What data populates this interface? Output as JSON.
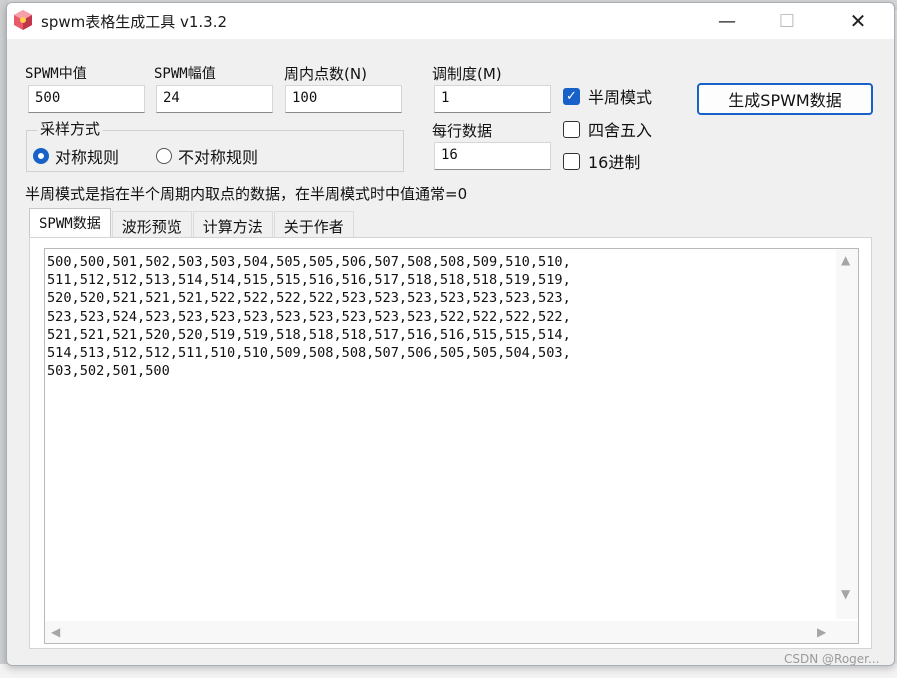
{
  "window": {
    "title": "spwm表格生成工具 v1.3.2",
    "min_glyph": "—",
    "max_glyph": "☐",
    "close_glyph": "✕"
  },
  "fields": {
    "center": {
      "label": "SPWM中值",
      "value": "500"
    },
    "amplitude": {
      "label": "SPWM幅值",
      "value": "24"
    },
    "points": {
      "label": "周内点数(N)",
      "value": "100"
    },
    "modulation": {
      "label": "调制度(M)",
      "value": "1"
    },
    "per_row": {
      "label": "每行数据",
      "value": "16"
    }
  },
  "sampling": {
    "title": "采样方式",
    "options": [
      {
        "label": "对称规则",
        "selected": true
      },
      {
        "label": "不对称规则",
        "selected": false
      }
    ]
  },
  "checkboxes": [
    {
      "label": "半周模式",
      "checked": true
    },
    {
      "label": "四舍五入",
      "checked": false
    },
    {
      "label": "16进制",
      "checked": false
    }
  ],
  "generate_button": "生成SPWM数据",
  "note": "半周模式是指在半个周期内取点的数据，在半周模式时中值通常=0",
  "tabs": [
    "SPWM数据",
    "波形预览",
    "计算方法",
    "关于作者"
  ],
  "output_text": "500,500,501,502,503,503,504,505,505,506,507,508,508,509,510,510,\n511,512,512,513,514,514,515,515,516,516,517,518,518,518,519,519,\n520,520,521,521,521,522,522,522,522,523,523,523,523,523,523,523,\n523,523,524,523,523,523,523,523,523,523,523,523,522,522,522,522,\n521,521,521,520,520,519,519,518,518,518,517,516,516,515,515,514,\n514,513,512,512,511,510,510,509,508,508,507,506,505,505,504,503,\n503,502,501,500",
  "watermark": "CSDN @Roger...",
  "colors": {
    "accent": "#1761c8"
  }
}
